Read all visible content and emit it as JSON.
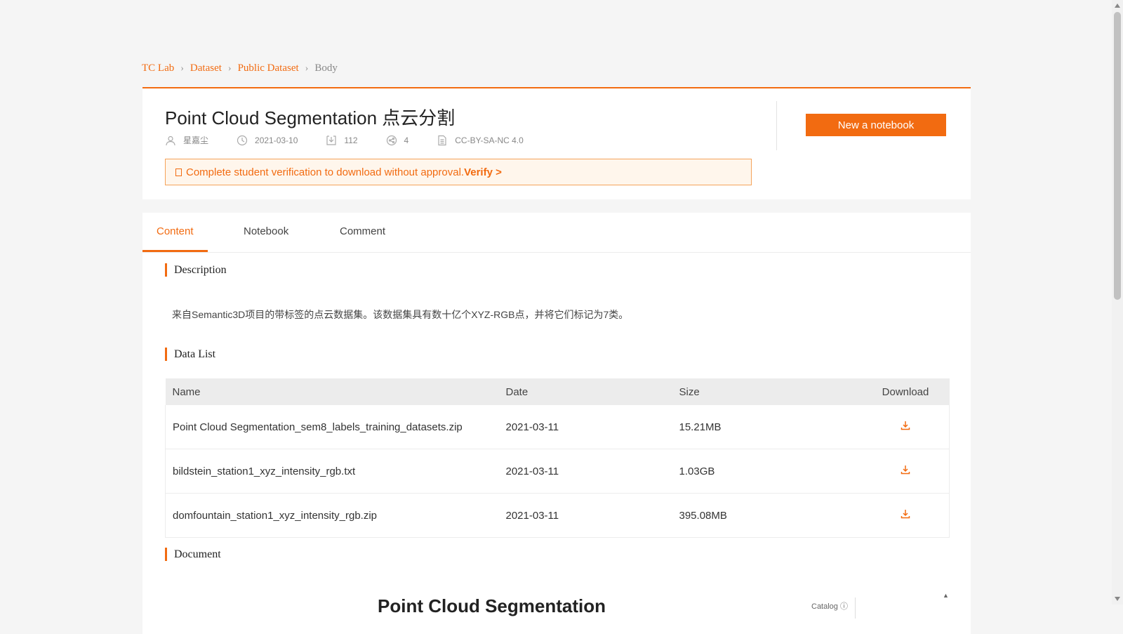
{
  "breadcrumb": {
    "items": [
      "TC Lab",
      "Dataset",
      "Public Dataset"
    ],
    "current": "Body"
  },
  "header": {
    "title": "Point Cloud Segmentation 点云分割",
    "meta": {
      "author": "星嘉尘",
      "date": "2021-03-10",
      "downloads": "112",
      "shares": "4",
      "license": "CC-BY-SA-NC 4.0"
    },
    "notice": {
      "text": "Complete student verification to download without approval.",
      "link": "Verify >"
    },
    "new_notebook_label": "New a notebook"
  },
  "tabs": [
    {
      "label": "Content",
      "active": true
    },
    {
      "label": "Notebook",
      "active": false
    },
    {
      "label": "Comment",
      "active": false
    }
  ],
  "description": {
    "heading": "Description",
    "text": "来自Semantic3D项目的带标签的点云数据集。该数据集具有数十亿个XYZ-RGB点，并将它们标记为7类。"
  },
  "data_list": {
    "heading": "Data List",
    "columns": [
      "Name",
      "Date",
      "Size",
      "Download"
    ],
    "rows": [
      {
        "name": "Point Cloud Segmentation_sem8_labels_training_datasets.zip",
        "date": "2021-03-11",
        "size": "15.21MB"
      },
      {
        "name": "bildstein_station1_xyz_intensity_rgb.txt",
        "date": "2021-03-11",
        "size": "1.03GB"
      },
      {
        "name": "domfountain_station1_xyz_intensity_rgb.zip",
        "date": "2021-03-11",
        "size": "395.08MB"
      }
    ]
  },
  "document": {
    "heading": "Document",
    "peek_title": "Point Cloud Segmentation",
    "catalog_label": "Catalog"
  },
  "icons": {
    "author": "user-icon",
    "date": "clock-icon",
    "downloads": "download-icon",
    "shares": "share-icon",
    "license": "document-icon",
    "row_download": "download-icon"
  },
  "colors": {
    "accent": "#f26b11",
    "notice_bg": "#fff6ec",
    "page_bg": "#f5f5f5"
  }
}
